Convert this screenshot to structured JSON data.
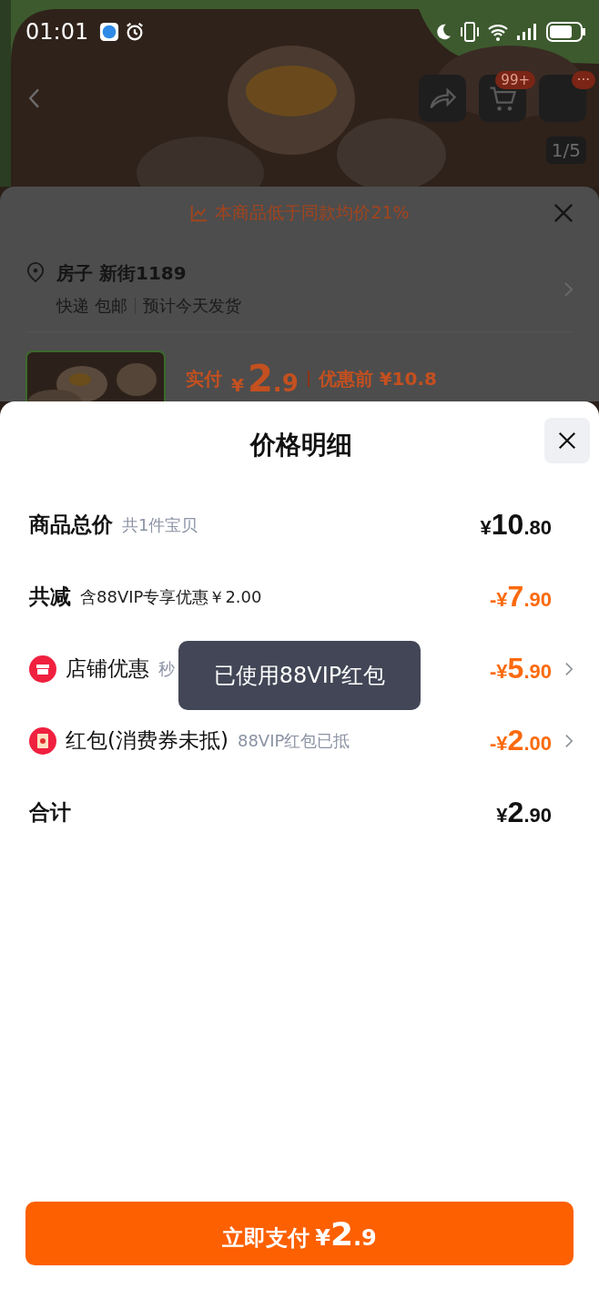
{
  "status_bar": {
    "time": "01:01"
  },
  "nav": {
    "cart_badge": "99+",
    "more_badge": "···",
    "page_indicator": "1/5"
  },
  "price_banner": {
    "text": "本商品低于同款均价21%"
  },
  "address": {
    "name": "房子 新街1189",
    "shipping": "快递 包邮",
    "eta": "预计今天发货"
  },
  "product": {
    "paid_label": "实付",
    "currency": "¥",
    "integer": "2",
    "decimal": ".9",
    "original_label": "优惠前 ¥10.8"
  },
  "sheet": {
    "title": "价格明细",
    "rows": [
      {
        "kind": "bold",
        "label": "商品总价",
        "sub": "共1件宝贝",
        "sub_muted": true,
        "amount": {
          "prefix": "¥",
          "integer": "10",
          "decimal": ".80"
        },
        "discount": false,
        "chevron": false
      },
      {
        "kind": "bold",
        "label": "共减",
        "sub": "含88VIP专享优惠￥2.00",
        "sub_muted": false,
        "amount": {
          "prefix": "-¥",
          "integer": "7",
          "decimal": ".90"
        },
        "discount": true,
        "chevron": false
      },
      {
        "kind": "store",
        "label": "店铺优惠",
        "sub": "秒",
        "sub_muted": true,
        "amount": {
          "prefix": "-¥",
          "integer": "5",
          "decimal": ".90"
        },
        "discount": true,
        "chevron": true
      },
      {
        "kind": "packet",
        "label": "红包(消费券未抵)",
        "sub": "88VIP红包已抵",
        "sub_muted": true,
        "amount": {
          "prefix": "-¥",
          "integer": "2",
          "decimal": ".00"
        },
        "discount": true,
        "chevron": true
      },
      {
        "kind": "bold",
        "label": "合计",
        "amount": {
          "prefix": "¥",
          "integer": "2",
          "decimal": ".90"
        },
        "discount": false,
        "chevron": false
      }
    ],
    "toast": "已使用88VIP红包",
    "pay_button": {
      "label": "立即支付",
      "currency": "¥",
      "integer": "2",
      "decimal": ".9"
    }
  }
}
